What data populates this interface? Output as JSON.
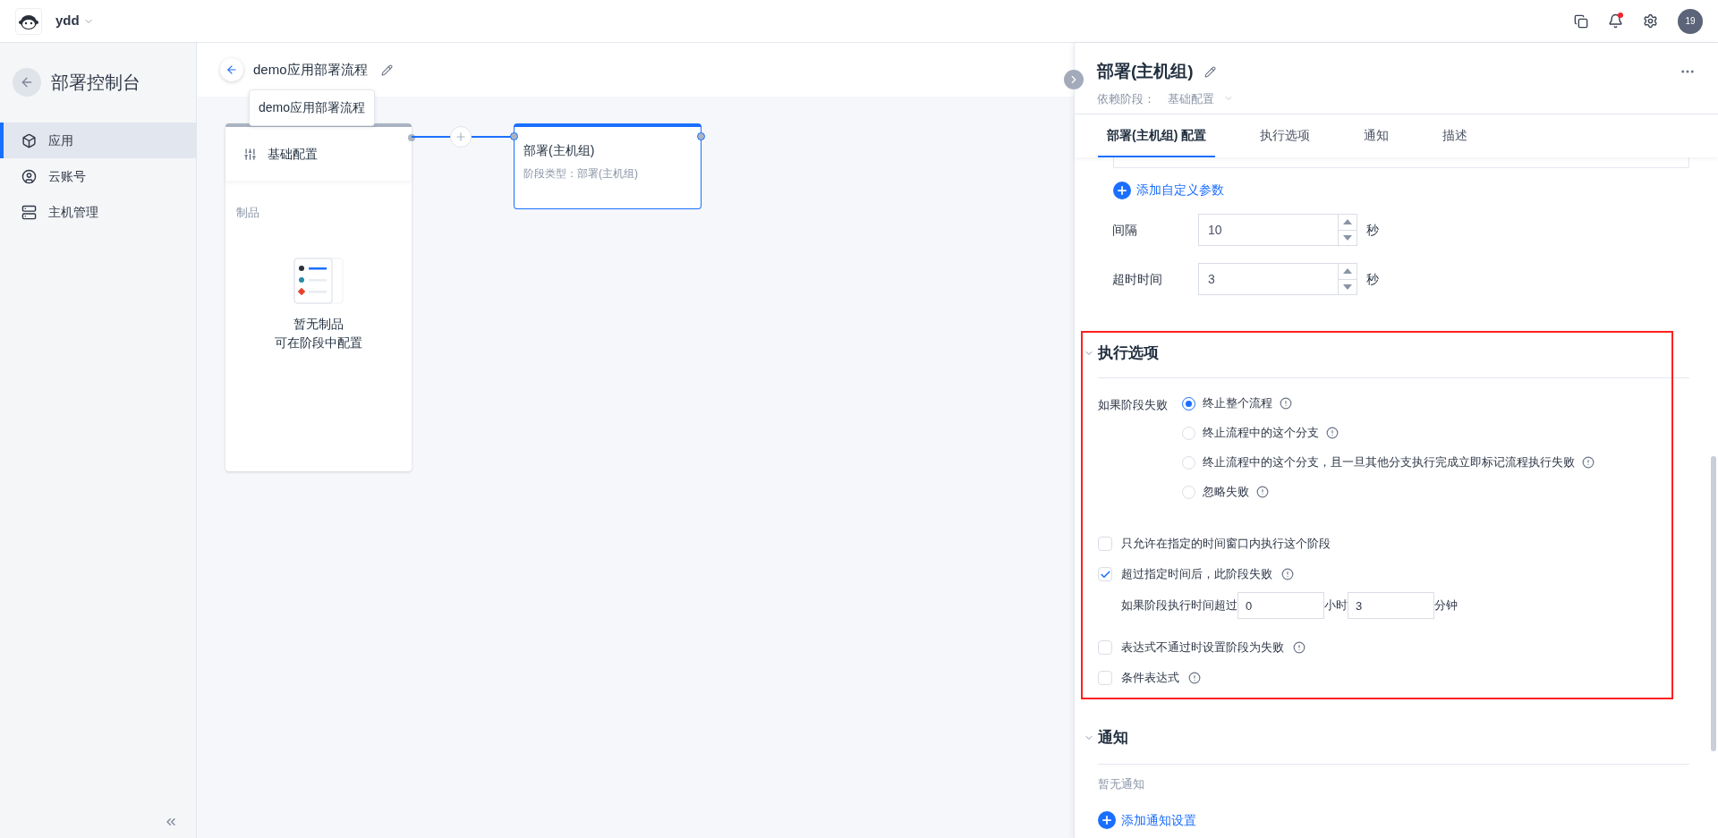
{
  "header": {
    "workspace": "ydd",
    "notification_dot": true,
    "avatar": "19"
  },
  "sidebar": {
    "title": "部署控制台",
    "items": [
      {
        "label": "应用",
        "selected": true
      },
      {
        "label": "云账号",
        "selected": false
      },
      {
        "label": "主机管理",
        "selected": false
      }
    ]
  },
  "pipeline": {
    "title": "demo应用部署流程",
    "tooltip": "demo应用部署流程",
    "source_stage": {
      "title": "基础配置",
      "section": "制品",
      "empty_title": "暂无制品",
      "empty_hint": "可在阶段中配置"
    },
    "stages": [
      {
        "title": "部署(主机组)",
        "subtitle": "阶段类型：部署(主机组)",
        "selected": true
      }
    ]
  },
  "panel": {
    "title": "部署(主机组)",
    "dependency_label": "依赖阶段：",
    "dependency_value": "基础配置",
    "tabs": [
      {
        "label": "部署(主机组) 配置",
        "selected": true
      },
      {
        "label": "执行选项",
        "selected": false
      },
      {
        "label": "通知",
        "selected": false
      },
      {
        "label": "描述",
        "selected": false
      }
    ],
    "add_param": "添加自定义参数",
    "fields": [
      {
        "label": "间隔",
        "value": "10",
        "unit": "秒"
      },
      {
        "label": "超时时间",
        "value": "3",
        "unit": "秒"
      }
    ],
    "exec": {
      "title": "执行选项",
      "expanded": true,
      "failure_label": "如果阶段失败",
      "options": [
        {
          "label": "终止整个流程",
          "selected": true
        },
        {
          "label": "终止流程中的这个分支",
          "selected": false
        },
        {
          "label": "终止流程中的这个分支，且一旦其他分支执行完成立即标记流程执行失败",
          "selected": false
        },
        {
          "label": "忽略失败",
          "selected": false
        }
      ],
      "checks": [
        {
          "label": "只允许在指定的时间窗口内执行这个阶段",
          "checked": false,
          "info": false
        },
        {
          "label": "超过指定时间后，此阶段失败",
          "checked": true,
          "info": true,
          "timeout": {
            "label": "如果阶段执行时间超过",
            "hours": "0",
            "hours_unit": "小时",
            "minutes": "3",
            "minutes_unit": "分钟"
          }
        },
        {
          "label": "表达式不通过时设置阶段为失败",
          "checked": false,
          "info": true
        },
        {
          "label": "条件表达式",
          "checked": false,
          "info": true
        }
      ]
    },
    "notify": {
      "title": "通知",
      "expanded": true,
      "empty": "暂无通知",
      "add": "添加通知设置"
    }
  }
}
